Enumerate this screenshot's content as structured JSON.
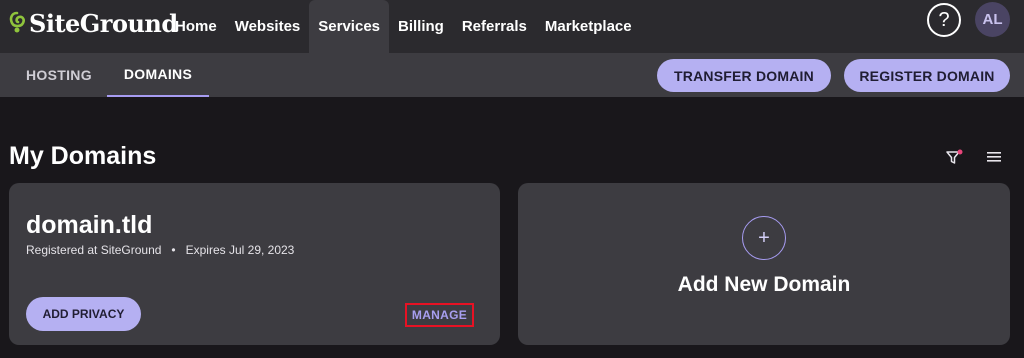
{
  "brand": {
    "name": "SiteGround",
    "logo_color": "#8fc43c"
  },
  "nav": {
    "items": [
      {
        "label": "Home",
        "active": false
      },
      {
        "label": "Websites",
        "active": false
      },
      {
        "label": "Services",
        "active": true
      },
      {
        "label": "Billing",
        "active": false
      },
      {
        "label": "Referrals",
        "active": false
      },
      {
        "label": "Marketplace",
        "active": false
      }
    ],
    "help_label": "?",
    "avatar_initials": "AL"
  },
  "subnav": {
    "tabs": [
      {
        "label": "HOSTING",
        "active": false
      },
      {
        "label": "DOMAINS",
        "active": true
      }
    ],
    "transfer_label": "TRANSFER DOMAIN",
    "register_label": "REGISTER DOMAIN"
  },
  "page": {
    "title": "My Domains",
    "filter_icon": "filter-icon",
    "list_icon": "list-view-icon"
  },
  "domain_card": {
    "name": "domain.tld",
    "registered": "Registered at SiteGround",
    "separator": "•",
    "expires": "Expires Jul 29, 2023",
    "privacy_label": "ADD PRIVACY",
    "manage_label": "MANAGE"
  },
  "add_card": {
    "plus": "+",
    "title": "Add New Domain"
  },
  "colors": {
    "accent": "#b5b0f2",
    "highlight_border": "#e81224",
    "background": "#19171b",
    "card": "#3d3c41"
  }
}
